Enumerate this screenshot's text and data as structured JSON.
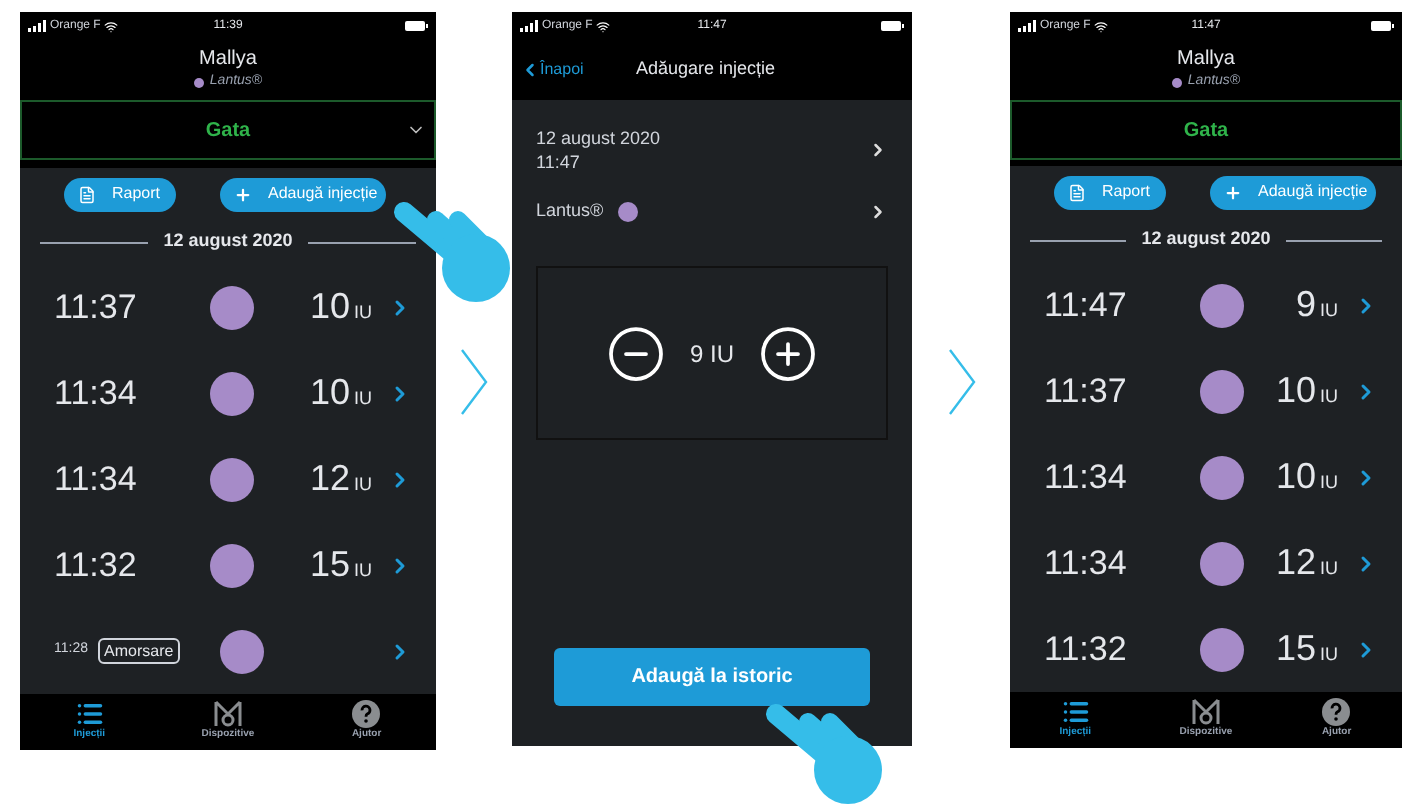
{
  "screens": [
    {
      "kind": "history",
      "status_bar": {
        "carrier": "Orange F",
        "time": "11:39"
      },
      "user": "Mallya",
      "insulin": "Lantus®",
      "status_dropdown": {
        "label": "Gata",
        "arrow": true
      },
      "buttons": [
        {
          "label": "Raport",
          "kind": "report"
        },
        {
          "label": "Adaugă injecție",
          "kind": "add"
        }
      ],
      "date": "12 august 2020",
      "entries": [
        {
          "kind": "dose",
          "time": "11:37",
          "dose": "10",
          "unit": "IU"
        },
        {
          "kind": "dose",
          "time": "11:34",
          "dose": "10",
          "unit": "IU"
        },
        {
          "kind": "dose",
          "time": "11:34",
          "dose": "12",
          "unit": "IU"
        },
        {
          "kind": "dose",
          "time": "11:32",
          "dose": "15",
          "unit": "IU"
        },
        {
          "kind": "priming",
          "time": "11:28",
          "tag": "Amorsare"
        }
      ],
      "tabs": [
        {
          "label": "Injecții",
          "kind": "list",
          "selected": true
        },
        {
          "label": "Dispozitive",
          "kind": "device",
          "selected": false
        },
        {
          "label": "Ajutor",
          "kind": "help",
          "selected": false
        }
      ]
    },
    {
      "kind": "add",
      "status_bar": {
        "carrier": "Orange F",
        "time": "11:47"
      },
      "back": "Înapoi",
      "title": "Adăugare injecție",
      "date": "12 august 2020",
      "time": "11:47",
      "insulin": "Lantus®",
      "dose": "9 IU",
      "submit": "Adaugă la istoric"
    },
    {
      "kind": "history",
      "status_bar": {
        "carrier": "Orange F",
        "time": "11:47"
      },
      "user": "Mallya",
      "insulin": "Lantus®",
      "status_dropdown": {
        "label": "Gata",
        "arrow": false
      },
      "buttons": [
        {
          "label": "Raport",
          "kind": "report"
        },
        {
          "label": "Adaugă injecție",
          "kind": "add"
        }
      ],
      "date": "12 august 2020",
      "entries": [
        {
          "kind": "dose",
          "time": "11:47",
          "dose": "9",
          "unit": "IU"
        },
        {
          "kind": "dose",
          "time": "11:37",
          "dose": "10",
          "unit": "IU"
        },
        {
          "kind": "dose",
          "time": "11:34",
          "dose": "10",
          "unit": "IU"
        },
        {
          "kind": "dose",
          "time": "11:34",
          "dose": "12",
          "unit": "IU"
        },
        {
          "kind": "dose",
          "time": "11:32",
          "dose": "15",
          "unit": "IU"
        }
      ],
      "tabs": [
        {
          "label": "Injecții",
          "kind": "list",
          "selected": true
        },
        {
          "label": "Dispozitive",
          "kind": "device",
          "selected": false
        },
        {
          "label": "Ajutor",
          "kind": "help",
          "selected": false
        }
      ]
    }
  ]
}
